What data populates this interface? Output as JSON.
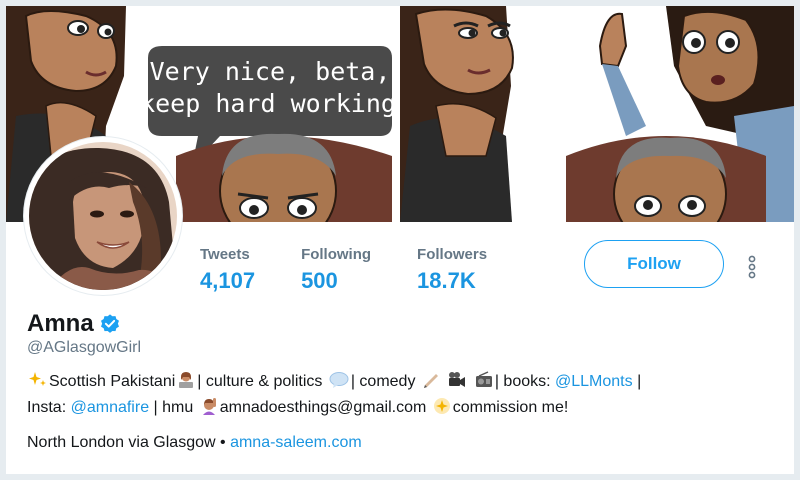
{
  "profile": {
    "name": "Amna",
    "handle": "@AGlasgowGirl",
    "follow_label": "Follow",
    "banner_speech": [
      "Very nice, beta,",
      "keep hard working"
    ]
  },
  "stats": [
    {
      "label": "Tweets",
      "value": "4,107"
    },
    {
      "label": "Following",
      "value": "500"
    },
    {
      "label": "Followers",
      "value": "18.7K"
    }
  ],
  "bio": {
    "line1_part1": "Scottish Pakistani",
    "line1_part2": "| culture & politics",
    "line1_part3": "| comedy",
    "line1_part4": "| books:",
    "line1_mention": "@LLMonts",
    "line1_part5": "|",
    "line2_part1": "Insta:",
    "line2_mention": "@amnafire",
    "line2_part2": "| hmu",
    "line2_email": "amnadoesthings@gmail.com",
    "line2_part3": "commission me!"
  },
  "location": {
    "place": "North London via Glasgow",
    "separator": "•",
    "url": "amna-saleem.com"
  },
  "icons": {
    "verified": "verified-badge-icon",
    "more": "more-vertical-icon"
  },
  "colors": {
    "link": "#1b95e0",
    "accent": "#1da1f2",
    "muted": "#657786",
    "background": "#e6ecf0"
  }
}
